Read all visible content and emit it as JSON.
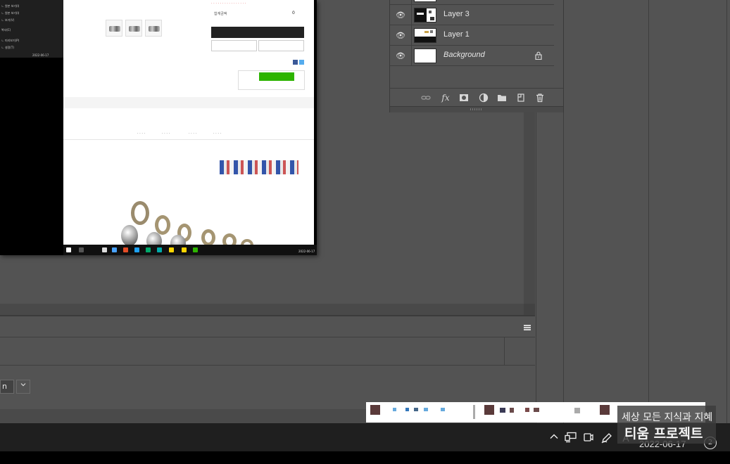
{
  "layers_panel": {
    "layers": [
      {
        "name": "Layer 3",
        "visible": true,
        "locked": false,
        "italic": false
      },
      {
        "name": "Layer 1",
        "visible": true,
        "locked": false,
        "italic": false
      },
      {
        "name": "Background",
        "visible": true,
        "locked": true,
        "italic": true
      }
    ],
    "toolbar_icons": [
      "link-icon",
      "fx-icon",
      "mask-icon",
      "adjustment-icon",
      "folder-icon",
      "new-layer-icon",
      "trash-icon"
    ]
  },
  "bottom_panel": {
    "dropdown_value": "n",
    "menu_icon": "hamburger-menu-icon"
  },
  "embedded_screenshot": {
    "clock_date": "2022-06-17"
  },
  "taskbar": {
    "date": "2022-06-17",
    "notification_count": "2",
    "tray_icons": [
      "chevron-up-icon",
      "network-icon",
      "camera-icon",
      "pen-icon",
      "ime-icon"
    ],
    "ime_label": "A"
  },
  "watermark": {
    "line1": "세상 모든 지식과 지혜",
    "line2": "티움 프로젝트"
  },
  "colors": {
    "workspace": "#535353",
    "panel_border": "#3e3e3e",
    "taskbar": "#1f1f1f",
    "npay_green": "#2db400"
  }
}
